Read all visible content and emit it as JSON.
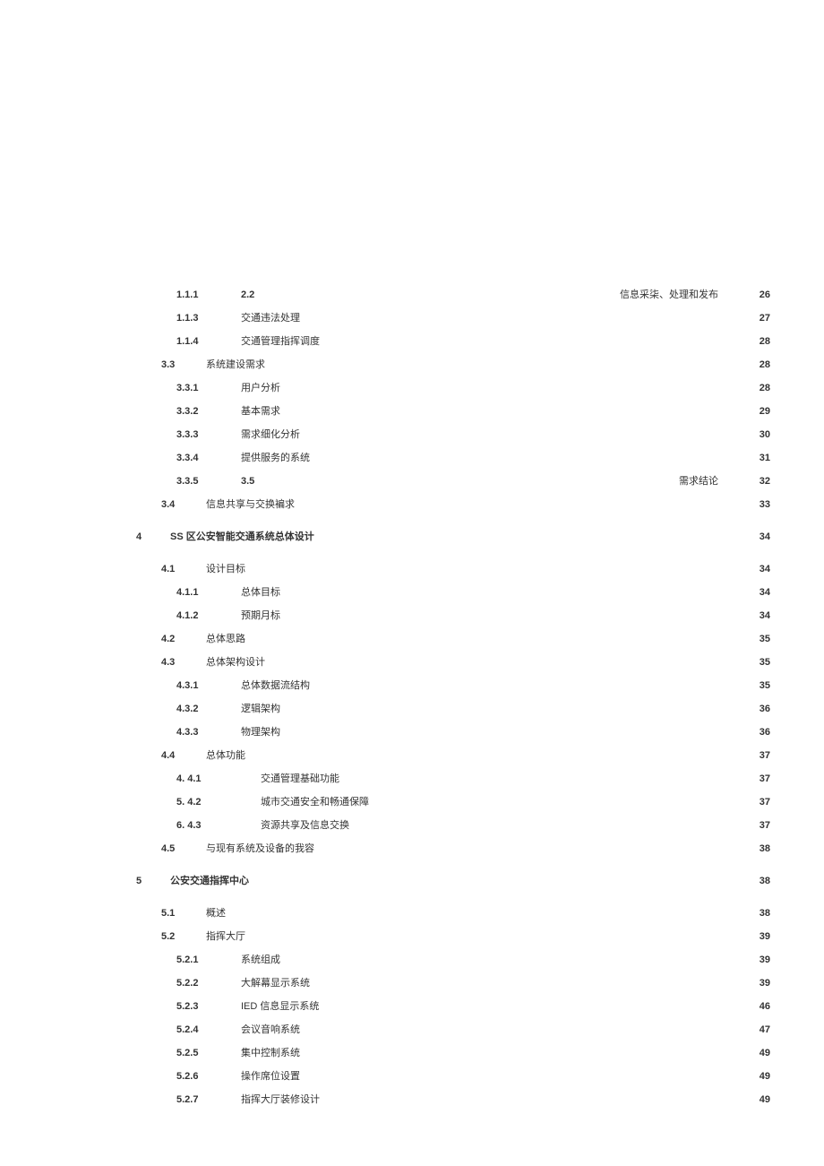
{
  "entries": [
    {
      "level": 3,
      "num": "1.1.1",
      "title": "2.2",
      "title_bold": true,
      "rightSuffix": "信息采柒、处理和发布",
      "page": "26",
      "page_far": true
    },
    {
      "level": 3,
      "num": "1.1.3",
      "title": "交通违法处理",
      "page": "27"
    },
    {
      "level": 3,
      "num": "1.1.4",
      "title": "交通管理指挥调度",
      "page": "28"
    },
    {
      "level": 2,
      "num": "3.3",
      "title": "系统建设需求",
      "page": "28"
    },
    {
      "level": 3,
      "num": "3.3.1",
      "title": "用户分析",
      "page": "28"
    },
    {
      "level": 3,
      "num": "3.3.2",
      "title": "基本需求",
      "page": "29"
    },
    {
      "level": 3,
      "num": "3.3.3",
      "title": "需求细化分析",
      "page": "30"
    },
    {
      "level": 3,
      "num": "3.3.4",
      "title": "提供服务的系统",
      "page": "31"
    },
    {
      "level": 3,
      "num": "3.3.5",
      "title": "3.5",
      "title_bold": true,
      "rightSuffix": "需求结论",
      "page": "32",
      "page_far": true
    },
    {
      "level": 2,
      "num": "3.4",
      "title": "信息共享与交换褊求",
      "page": "33"
    },
    {
      "gap": true
    },
    {
      "level": 1,
      "num": "4",
      "title": "SS 区公安智能交通系统总体设计",
      "title_bold": true,
      "page": "34"
    },
    {
      "gap": true
    },
    {
      "level": 2,
      "num": "4.1",
      "title": "设计目标",
      "page": "34"
    },
    {
      "level": 3,
      "num": "4.1.1",
      "title": "总体目标",
      "page": "34"
    },
    {
      "level": 3,
      "num": "4.1.2",
      "title": "预期月标",
      "page": "34"
    },
    {
      "level": 2,
      "num": "4.2",
      "title": "总体思路",
      "page": "35"
    },
    {
      "level": 2,
      "num": "4.3",
      "title": "总体架构设计",
      "page": "35"
    },
    {
      "level": 3,
      "num": "4.3.1",
      "title": "总体数据流结构",
      "page": "35"
    },
    {
      "level": 3,
      "num": "4.3.2",
      "title": "逻辑架构",
      "page": "36"
    },
    {
      "level": 3,
      "num": "4.3.3",
      "title": "物理架构",
      "page": "36"
    },
    {
      "level": 2,
      "num": "4.4",
      "title": "总体功能",
      "page": "37"
    },
    {
      "level": 4,
      "num": "4.   4.1",
      "title": "交通管理基础功能",
      "page": "37"
    },
    {
      "level": 4,
      "num": "5.   4.2",
      "title": "城市交通安全和畅通保障",
      "page": "37"
    },
    {
      "level": 4,
      "num": "6.   4.3",
      "title": "资源共享及信息交换",
      "page": "37"
    },
    {
      "level": 2,
      "num": "4.5",
      "title": "与现有系统及设备的我容",
      "page": "38"
    },
    {
      "gap": true
    },
    {
      "level": 1,
      "num": "5",
      "title": "公安交通指挥中心",
      "title_bold": true,
      "page": "38"
    },
    {
      "gap": true
    },
    {
      "level": 2,
      "num": "5.1",
      "title": "概述",
      "page": "38"
    },
    {
      "level": 2,
      "num": "5.2",
      "title": "指挥大厅",
      "page": "39"
    },
    {
      "level": 3,
      "num": "5.2.1",
      "title": "系统组成",
      "page": "39"
    },
    {
      "level": 3,
      "num": "5.2.2",
      "title": "大解幕显示系统",
      "page": "39"
    },
    {
      "level": 3,
      "num": "5.2.3",
      "title": "IED 信息显示系统",
      "page": "46"
    },
    {
      "level": 3,
      "num": "5.2.4",
      "title": "会议音响系统",
      "page": "47"
    },
    {
      "level": 3,
      "num": "5.2.5",
      "title": "集中控制系统",
      "page": "49"
    },
    {
      "level": 3,
      "num": "5.2.6",
      "title": "操作席位设置",
      "page": "49"
    },
    {
      "level": 3,
      "num": "5.2.7",
      "title": "指挥大厅装修设计",
      "page": "49"
    }
  ]
}
